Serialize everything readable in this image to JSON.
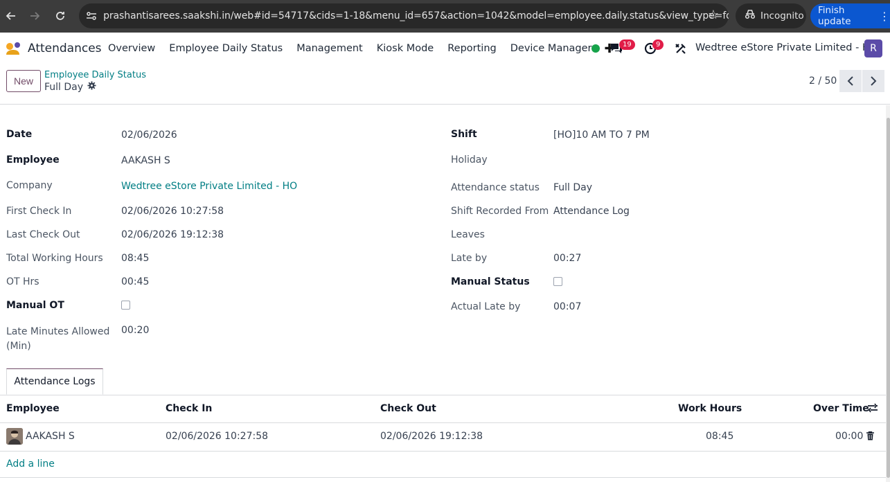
{
  "browser": {
    "url": "prashantisarees.saakshi.in/web#id=54717&cids=1-18&menu_id=657&action=1042&model=employee.daily.status&view_type=form",
    "incognito_label": "Incognito",
    "update_label": "Finish update"
  },
  "navbar": {
    "app_name": "Attendances",
    "menu": [
      "Overview",
      "Employee Daily Status",
      "Management",
      "Kiosk Mode",
      "Reporting",
      "Device Manager"
    ],
    "messages_count": "19",
    "activities_count": "9",
    "company": "Wedtree eStore Private Limited - HO",
    "avatar_letter": "R"
  },
  "control_panel": {
    "new_label": "New",
    "breadcrumb_parent": "Employee Daily Status",
    "breadcrumb_current": "Full Day",
    "pager": "2 / 50"
  },
  "form": {
    "left": [
      {
        "label": "Date",
        "value": "02/06/2026"
      },
      {
        "label": "Employee",
        "value": "AAKASH S"
      },
      {
        "label": "Company",
        "value": "Wedtree eStore Private Limited - HO"
      },
      {
        "label": "First Check In",
        "value": "02/06/2026 10:27:58"
      },
      {
        "label": "Last Check Out",
        "value": "02/06/2026 19:12:38"
      },
      {
        "label": "Total Working Hours",
        "value": "08:45"
      },
      {
        "label": "OT Hrs",
        "value": "00:45"
      },
      {
        "label": "Manual OT",
        "value": ""
      },
      {
        "label": "Late Minutes Allowed (Min)",
        "value": "00:20"
      }
    ],
    "right": [
      {
        "label": "Shift",
        "value": "[HO]10 AM TO 7 PM"
      },
      {
        "label": "Holiday",
        "value": ""
      },
      {
        "label": "Attendance status",
        "value": "Full Day"
      },
      {
        "label": "Shift Recorded From",
        "value": "Attendance Log"
      },
      {
        "label": "Leaves",
        "value": ""
      },
      {
        "label": "Late by",
        "value": "00:27"
      },
      {
        "label": "Manual Status",
        "value": ""
      },
      {
        "label": "Actual Late by",
        "value": "00:07"
      }
    ]
  },
  "logs": {
    "tab_label": "Attendance Logs",
    "columns": [
      "Employee",
      "Check In",
      "Check Out",
      "Work Hours",
      "Over Time"
    ],
    "rows": [
      {
        "employee": "AAKASH S",
        "check_in": "02/06/2026 10:27:58",
        "check_out": "02/06/2026 19:12:38",
        "work_hours": "08:45",
        "over_time": "00:00"
      }
    ],
    "add_line": "Add a line"
  }
}
